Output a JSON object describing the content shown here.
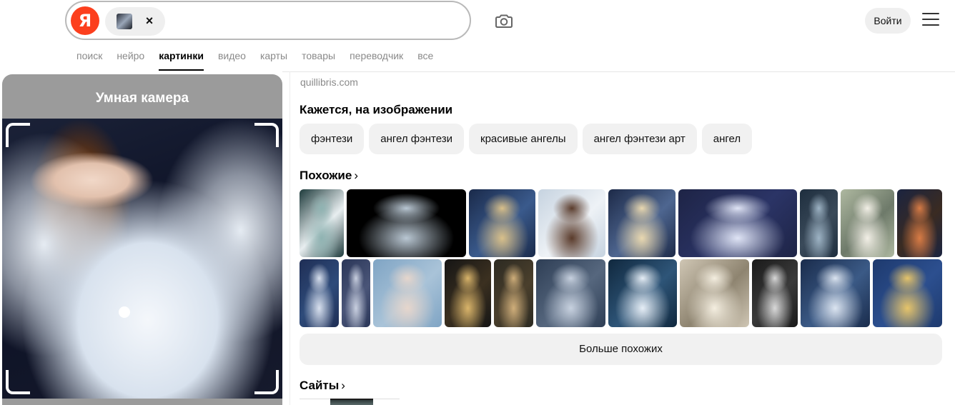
{
  "header": {
    "logo_letter": "Я",
    "query_chip_close": "×",
    "login_label": "Войти"
  },
  "nav": {
    "tabs": [
      {
        "label": "поиск",
        "active": false
      },
      {
        "label": "нейро",
        "active": false
      },
      {
        "label": "картинки",
        "active": true
      },
      {
        "label": "видео",
        "active": false
      },
      {
        "label": "карты",
        "active": false
      },
      {
        "label": "товары",
        "active": false
      },
      {
        "label": "переводчик",
        "active": false
      },
      {
        "label": "все",
        "active": false
      }
    ]
  },
  "camera_panel": {
    "title": "Умная камера"
  },
  "results": {
    "source": "quillibris.com",
    "detected_title": "Кажется, на изображении",
    "tags": [
      "фэнтези",
      "ангел фэнтези",
      "красивые ангелы",
      "ангел фэнтези арт",
      "ангел"
    ],
    "similar_title": "Похожие",
    "similar_arrow": "›",
    "similar_rows": [
      [
        {
          "colors": [
            "#1e3b3c",
            "#8fb3b2",
            "#e8eef0"
          ]
        },
        {
          "colors": [
            "#000000",
            "#b9c7d3",
            "#000000"
          ]
        },
        {
          "colors": [
            "#1a2a4a",
            "#d9c08a",
            "#3a5a8c"
          ]
        },
        {
          "colors": [
            "#c6d3e0",
            "#5a3b2b",
            "#eef2f6"
          ]
        },
        {
          "colors": [
            "#1d2a48",
            "#e9d8b0",
            "#4e6690"
          ]
        },
        {
          "colors": [
            "#1e2446",
            "#dfe4f5",
            "#2b3466"
          ]
        },
        {
          "colors": [
            "#1e2e3e",
            "#9db3c4",
            "#3a4a5a"
          ]
        },
        {
          "colors": [
            "#aeb8a0",
            "#f2efe6",
            "#6e7a6a"
          ]
        },
        {
          "colors": [
            "#1b2440",
            "#d77b45",
            "#3a2b22"
          ]
        }
      ],
      [
        {
          "colors": [
            "#1f2e55",
            "#d8e0ee",
            "#2e4b7a"
          ]
        },
        {
          "colors": [
            "#2a3658",
            "#c8cfdf",
            "#4a5578"
          ]
        },
        {
          "colors": [
            "#7fa4c4",
            "#e6d6cc",
            "#a9c3d8"
          ]
        },
        {
          "colors": [
            "#151515",
            "#d9b46a",
            "#3b3020"
          ]
        },
        {
          "colors": [
            "#2c2a22",
            "#cfae7a",
            "#4a3f2c"
          ]
        },
        {
          "colors": [
            "#2e3e55",
            "#c7d1df",
            "#56677e"
          ]
        },
        {
          "colors": [
            "#10283e",
            "#e6eef6",
            "#2e5578"
          ]
        },
        {
          "colors": [
            "#cfc6b4",
            "#f4eee0",
            "#8e8470"
          ]
        },
        {
          "colors": [
            "#1a1a1a",
            "#d8d8d8",
            "#3a3a3a"
          ]
        },
        {
          "colors": [
            "#1a2c4c",
            "#dbe4f0",
            "#3b5a86"
          ]
        },
        {
          "colors": [
            "#1e3a6e",
            "#e6c46a",
            "#2c4f8f"
          ]
        }
      ]
    ],
    "more_label": "Больше похожих",
    "sites_title": "Сайты",
    "sites_arrow": "›"
  }
}
